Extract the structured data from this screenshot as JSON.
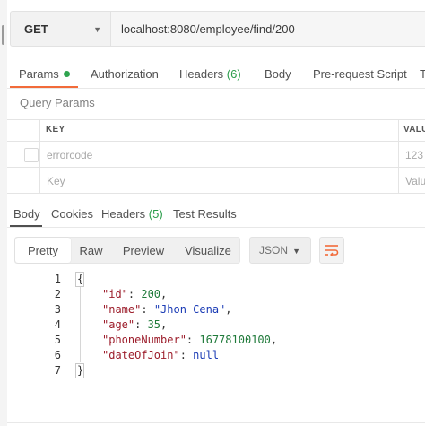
{
  "request": {
    "method": "GET",
    "url": "localhost:8080/employee/find/200"
  },
  "request_tabs": [
    {
      "label": "Params"
    },
    {
      "label": "Authorization"
    },
    {
      "label": "Headers",
      "count": "(6)"
    },
    {
      "label": "Body"
    },
    {
      "label": "Pre-request Script"
    },
    {
      "label": "T"
    }
  ],
  "query_params": {
    "section_label": "Query Params",
    "columns": [
      "KEY",
      "VALU"
    ],
    "rows": [
      {
        "key": "errorcode",
        "value": "123"
      },
      {
        "key": "Key",
        "value": "Valu"
      }
    ]
  },
  "response_tabs": [
    {
      "label": "Body"
    },
    {
      "label": "Cookies"
    },
    {
      "label": "Headers",
      "count": "(5)"
    },
    {
      "label": "Test Results"
    }
  ],
  "view_modes": [
    "Pretty",
    "Raw",
    "Preview",
    "Visualize"
  ],
  "format": "JSON",
  "code": {
    "line_numbers": [
      "1",
      "2",
      "3",
      "4",
      "5",
      "6",
      "7"
    ],
    "open_brace": "{",
    "close_brace": "}",
    "fields": [
      {
        "key": "\"id\"",
        "value": "200",
        "sep": ","
      },
      {
        "key": "\"name\"",
        "value": "\"Jhon Cena\"",
        "sep": ","
      },
      {
        "key": "\"age\"",
        "value": "35",
        "sep": ","
      },
      {
        "key": "\"phoneNumber\"",
        "value": "16778100100",
        "sep": ","
      },
      {
        "key": "\"dateOfJoin\"",
        "value": "null",
        "sep": ""
      }
    ]
  },
  "colors": {
    "accent_orange": "#f26b3a",
    "status_green": "#2fa44f",
    "json_key": "#9c1c2a",
    "json_string": "#1a3bb5",
    "json_number": "#1f7a3a"
  }
}
